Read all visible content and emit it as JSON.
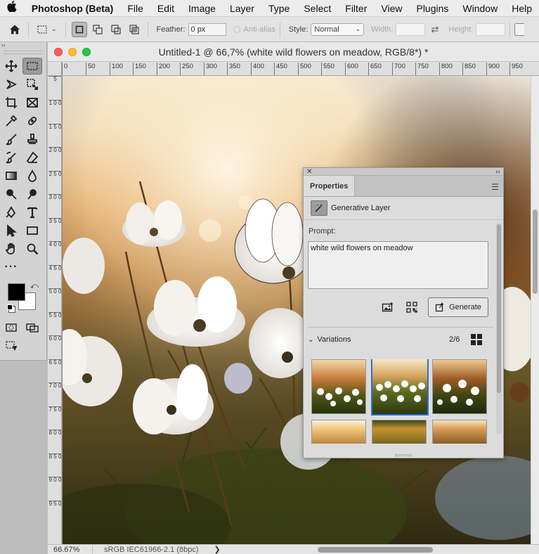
{
  "menubar": {
    "app": "Photoshop (Beta)",
    "items": [
      "File",
      "Edit",
      "Image",
      "Layer",
      "Type",
      "Select",
      "Filter",
      "View",
      "Plugins",
      "Window",
      "Help"
    ]
  },
  "options": {
    "feather_label": "Feather:",
    "feather_value": "0 px",
    "antialias_label": "Anti-alias",
    "style_label": "Style:",
    "style_value": "Normal",
    "width_label": "Width:",
    "height_label": "Height:"
  },
  "document": {
    "title": "Untitled-1 @ 66,7% (white wild flowers on meadow, RGB/8*) *",
    "ruler_h": [
      "0",
      "50",
      "100",
      "150",
      "200",
      "250",
      "300",
      "350",
      "400",
      "450",
      "500",
      "550",
      "600",
      "650",
      "700",
      "750",
      "800",
      "850",
      "900",
      "950"
    ],
    "ruler_v": [
      "5",
      "1 0 0",
      "1 5 0",
      "2 0 0",
      "2 5 0",
      "3 0 0",
      "3 5 0",
      "4 0 0",
      "4 5 0",
      "5 0 0",
      "5 5 0",
      "6 0 0",
      "6 5 0",
      "7 0 0",
      "7 5 0",
      "8 0 0",
      "8 5 0",
      "9 0 0",
      "9 5 0"
    ],
    "zoom": "66.67%",
    "profile": "sRGB IEC61966-2.1 (8bpc)",
    "status_arrow": "❯"
  },
  "properties": {
    "tab": "Properties",
    "layer_type": "Generative Layer",
    "prompt_label": "Prompt:",
    "prompt_text": "white wild flowers on meadow",
    "generate_label": "Generate",
    "variations_label": "Variations",
    "variations_count": "2/6",
    "selected_variation": 2
  },
  "colors": {
    "foreground": "#000000",
    "background": "#ffffff",
    "accent": "#2b6fe0"
  }
}
